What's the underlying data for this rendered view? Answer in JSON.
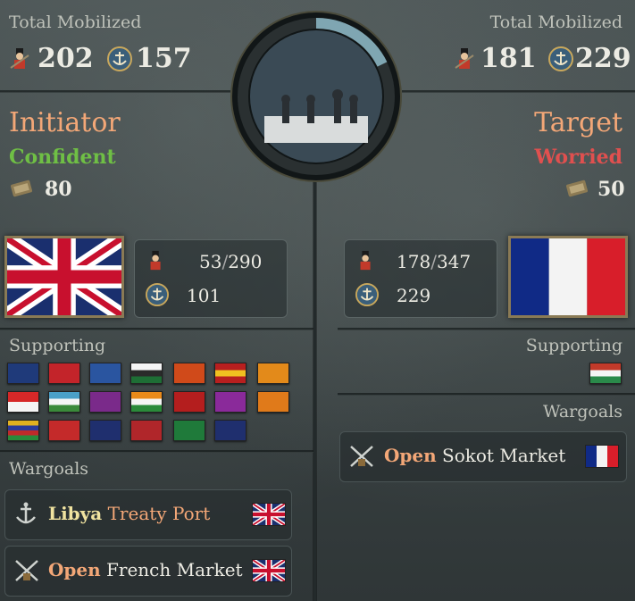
{
  "left": {
    "total_label": "Total Mobilized",
    "army": "202",
    "navy": "157",
    "role": "Initiator",
    "stance": "Confident",
    "stance_color": "#6fbf45",
    "influence": "80",
    "troops": "53",
    "troops_max": "290",
    "ships": "101",
    "country_flag": "united-kingdom-flag",
    "supporting_label": "Supporting",
    "wargoals_label": "Wargoals",
    "wargoals": [
      {
        "part1": "Libya",
        "part2": "Treaty Port",
        "icon": "anchor-icon",
        "flag": "united-kingdom-flag"
      },
      {
        "part1": "Open",
        "part2": "French Market",
        "icon": "crossed-swords-icon",
        "flag": "united-kingdom-flag"
      }
    ]
  },
  "right": {
    "total_label": "Total Mobilized",
    "army": "181",
    "navy": "229",
    "role": "Target",
    "stance": "Worried",
    "stance_color": "#e0504f",
    "influence": "50",
    "troops": "178",
    "troops_max": "347",
    "ships": "229",
    "country_flag": "france-flag",
    "supporting_label": "Supporting",
    "wargoals_label": "Wargoals",
    "wargoals": [
      {
        "part1": "Open",
        "part2": "Sokot Market",
        "icon": "crossed-swords-icon",
        "flag": "france-flag"
      }
    ]
  },
  "center": {
    "image": "chess-pieces-emblem",
    "progress_fraction": 0.22
  }
}
